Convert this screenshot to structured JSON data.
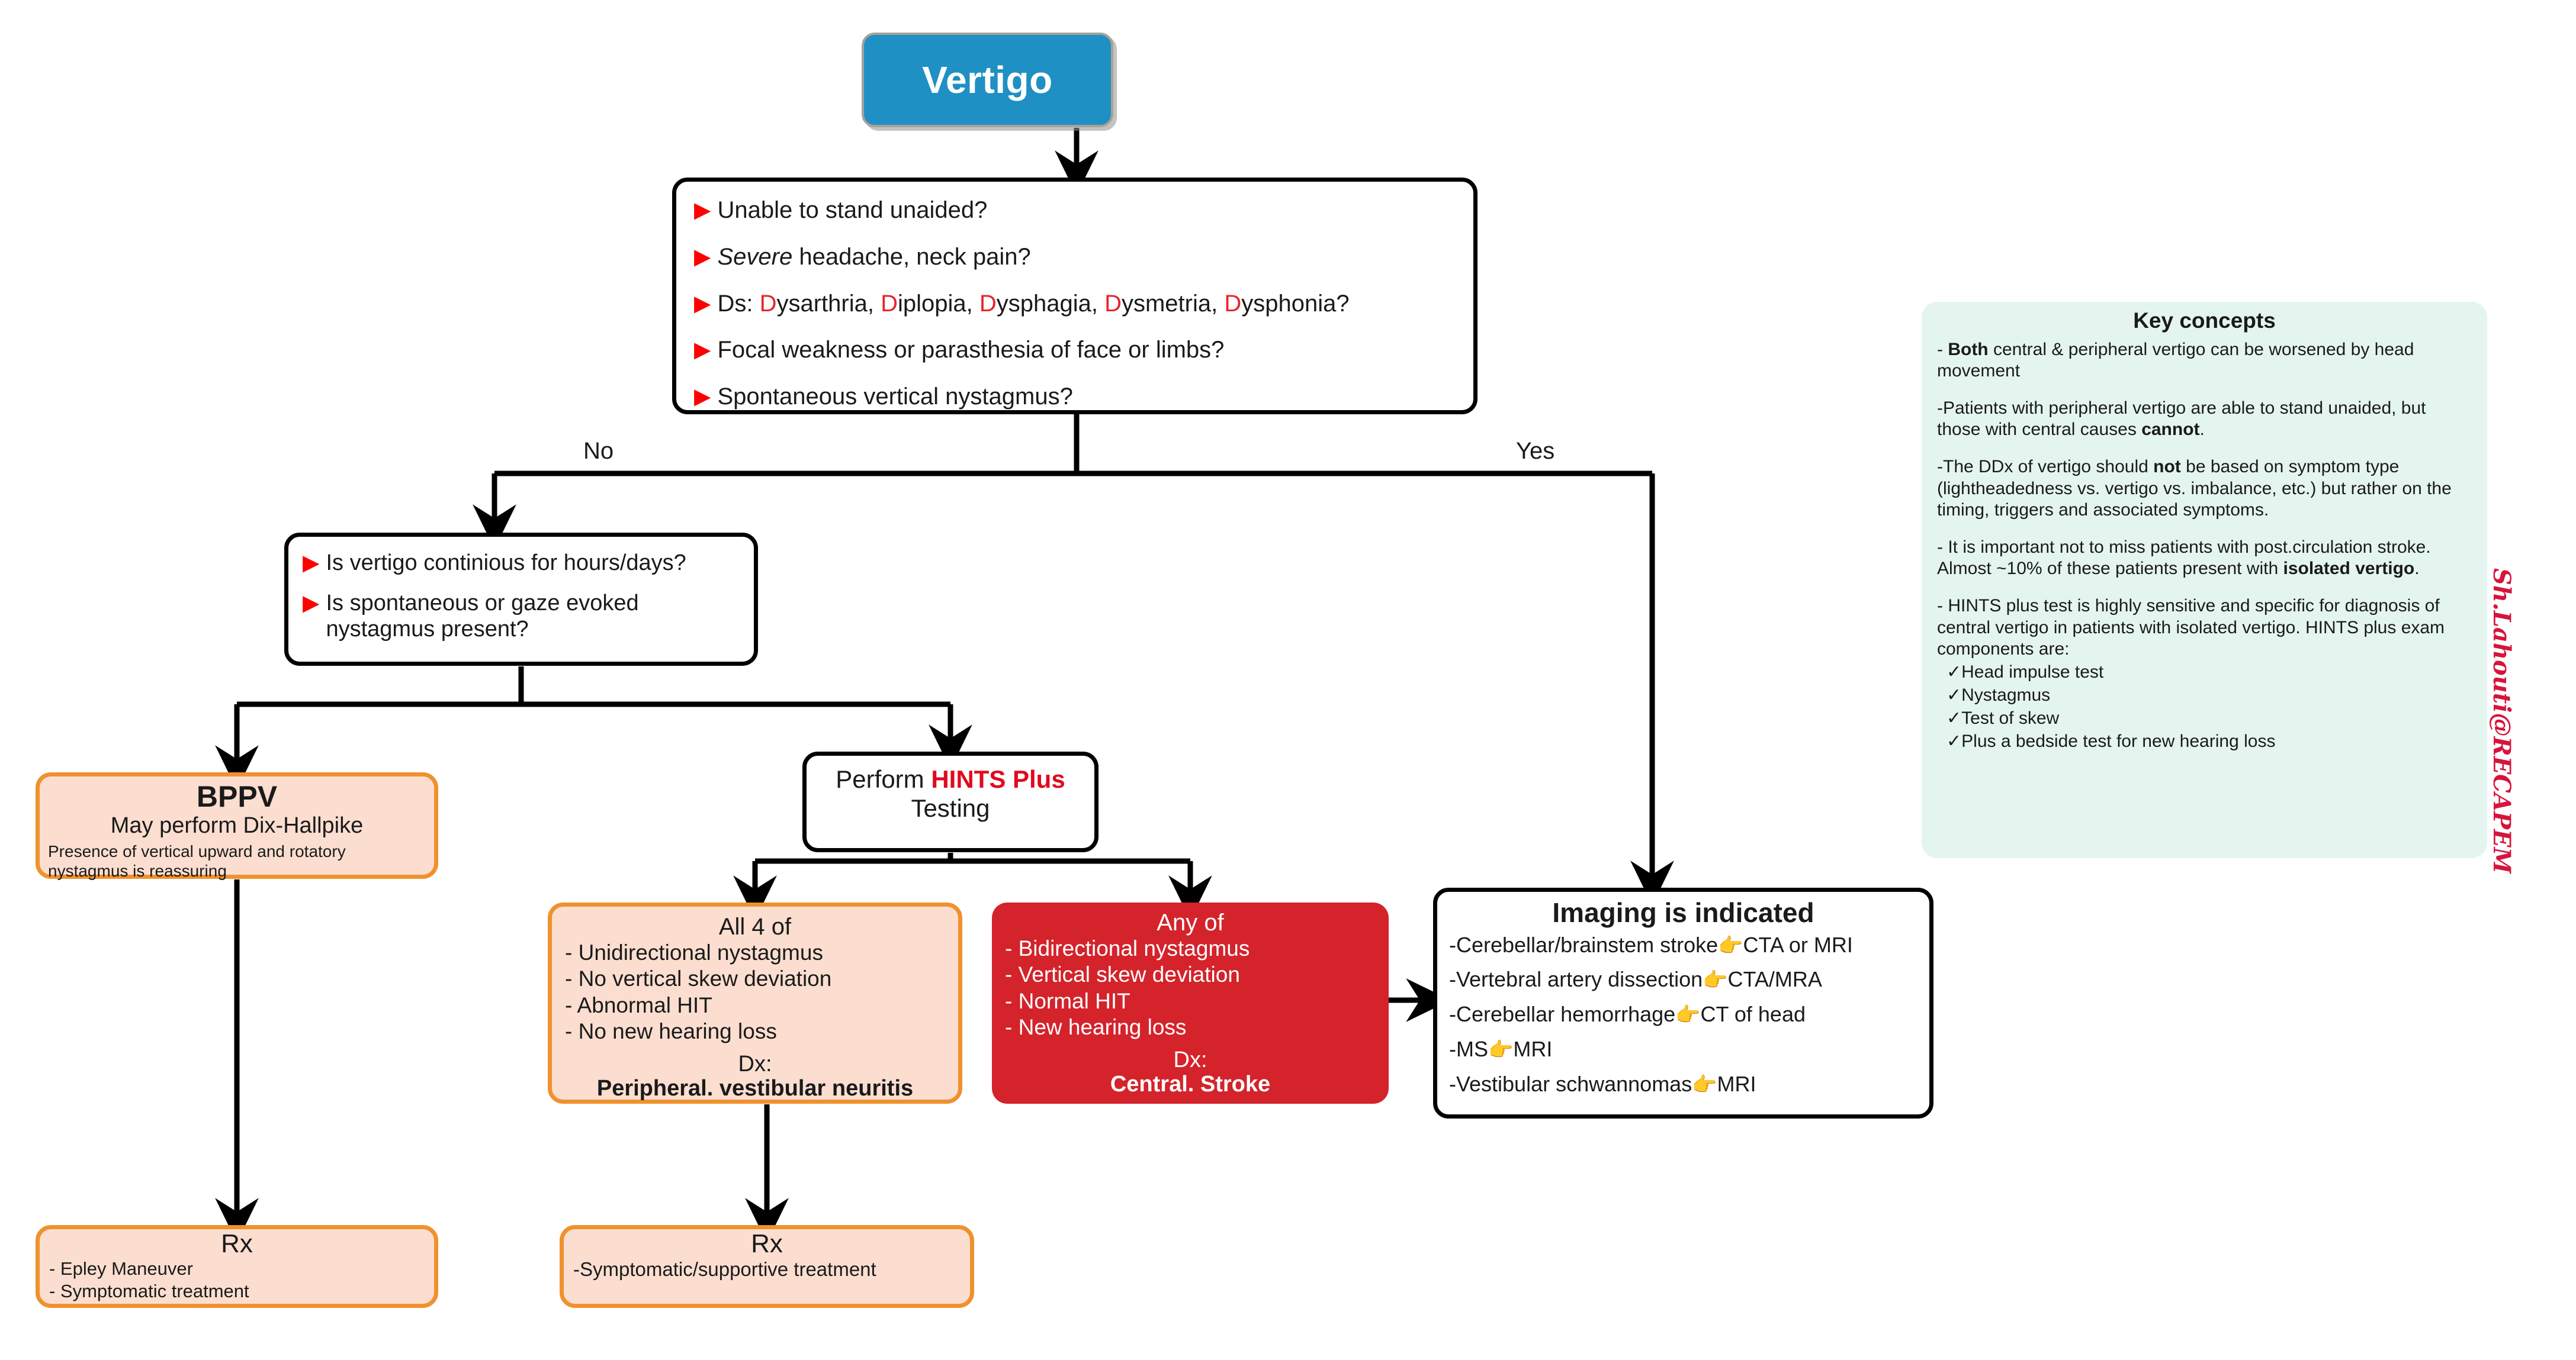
{
  "title": "Vertigo",
  "root": {
    "label": "Vertigo"
  },
  "symptom_box": {
    "bullet_icon": "red-triangle-bullet",
    "items": [
      {
        "segments": [
          {
            "text": "Unable to stand unaided?",
            "style": "normal"
          }
        ]
      },
      {
        "segments": [
          {
            "text": "Severe",
            "style": "italic"
          },
          {
            "text": " headache, neck pain?",
            "style": "normal"
          }
        ]
      },
      {
        "segments": [
          {
            "text": "Ds: ",
            "style": "normal"
          },
          {
            "text": "D",
            "style": "red"
          },
          {
            "text": "ysarthria, ",
            "style": "normal"
          },
          {
            "text": "D",
            "style": "red"
          },
          {
            "text": "iplopia, ",
            "style": "normal"
          },
          {
            "text": "D",
            "style": "red"
          },
          {
            "text": "ysphagia, ",
            "style": "normal"
          },
          {
            "text": "D",
            "style": "red"
          },
          {
            "text": "ysmetria, ",
            "style": "normal"
          },
          {
            "text": "D",
            "style": "red"
          },
          {
            "text": "ysphonia?",
            "style": "normal"
          }
        ]
      },
      {
        "segments": [
          {
            "text": "Focal weakness or parasthesia of face or limbs?",
            "style": "normal"
          }
        ]
      },
      {
        "segments": [
          {
            "text": "Spontaneous vertical nystagmus?",
            "style": "normal"
          }
        ]
      }
    ]
  },
  "edges": {
    "no_label": "No",
    "yes_label": "Yes"
  },
  "decision2": {
    "bullet_icon": "red-triangle-bullet",
    "items": [
      "Is vertigo continious for hours/days?",
      "Is spontaneous or gaze evoked nystagmus present?"
    ]
  },
  "bppv": {
    "title": "BPPV",
    "line2": "May perform Dix-Hallpike",
    "line3": "Presence of vertical upward and rotatory nystagmus is reassuring"
  },
  "hints": {
    "prefix": "Perform ",
    "highlight": "HINTS Plus",
    "suffix": "Testing"
  },
  "peripheral": {
    "header": "All 4 of",
    "items": [
      "- Unidirectional nystagmus",
      "- No vertical skew deviation",
      "- Abnormal HIT",
      "- No new hearing loss"
    ],
    "dx_label": "Dx:",
    "dx_value": "Peripheral. vestibular neuritis"
  },
  "central": {
    "header": "Any of",
    "items": [
      "- Bidirectional nystagmus",
      "- Vertical skew deviation",
      "- Normal HIT",
      "- New hearing loss"
    ],
    "dx_label": "Dx:",
    "dx_value": "Central. Stroke"
  },
  "imaging": {
    "header": "Imaging is indicated",
    "pointer_icon": "pointing-right-hand",
    "items": [
      {
        "cause": "-Cerebellar/brainstem stroke",
        "test": "CTA or MRI"
      },
      {
        "cause": "-Vertebral artery dissection",
        "test": "CTA/MRA"
      },
      {
        "cause": "-Cerebellar hemorrhage",
        "test": "CT of head"
      },
      {
        "cause": "-MS",
        "test": "MRI"
      },
      {
        "cause": "-Vestibular schwannomas",
        "test": "MRI"
      }
    ]
  },
  "rx_bppv": {
    "header": "Rx",
    "items": [
      "- Epley Maneuver",
      "- Symptomatic treatment"
    ]
  },
  "rx_peripheral": {
    "header": "Rx",
    "items": [
      "-Symptomatic/supportive treatment"
    ]
  },
  "key_concepts": {
    "header": "Key concepts",
    "paragraphs": [
      {
        "segments": [
          {
            "text": "- ",
            "style": "normal"
          },
          {
            "text": "Both",
            "style": "bold"
          },
          {
            "text": " central & peripheral vertigo can be worsened by head movement",
            "style": "normal"
          }
        ]
      },
      {
        "segments": [
          {
            "text": "-Patients with peripheral vertigo are able to stand unaided, but those with central causes ",
            "style": "normal"
          },
          {
            "text": "cannot",
            "style": "bold"
          },
          {
            "text": ".",
            "style": "normal"
          }
        ]
      },
      {
        "segments": [
          {
            "text": "-The DDx of vertigo should ",
            "style": "normal"
          },
          {
            "text": "not",
            "style": "bold"
          },
          {
            "text": " be based on symptom type (lightheadedness vs. vertigo vs. imbalance, etc.) but rather on the timing, triggers and associated symptoms.",
            "style": "normal"
          }
        ]
      },
      {
        "segments": [
          {
            "text": "- It is important not to miss patients with post.circulation stroke. Almost ~10% of these patients present with ",
            "style": "normal"
          },
          {
            "text": "isolated vertigo",
            "style": "bold"
          },
          {
            "text": ".",
            "style": "normal"
          }
        ]
      },
      {
        "segments": [
          {
            "text": "- HINTS plus test is highly sensitive and specific for diagnosis of central vertigo in patients with isolated vertigo. HINTS plus exam components are:",
            "style": "normal"
          }
        ]
      }
    ],
    "check_icon": "check-mark",
    "checklist": [
      "Head impulse test",
      "Nystagmus",
      "Test of skew",
      "Plus a bedside test for new hearing loss"
    ]
  },
  "watermark": {
    "text": "Sh.Lahouti@RECAPEM"
  },
  "colors": {
    "header_blue": "#1f90c4",
    "peach_fill": "#fbded0",
    "orange_border": "#f0912d",
    "alert_red": "#d4232b",
    "accent_red": "#e8232a",
    "teal_panel": "#e4f5f0",
    "watermark_red": "#d6143c"
  }
}
